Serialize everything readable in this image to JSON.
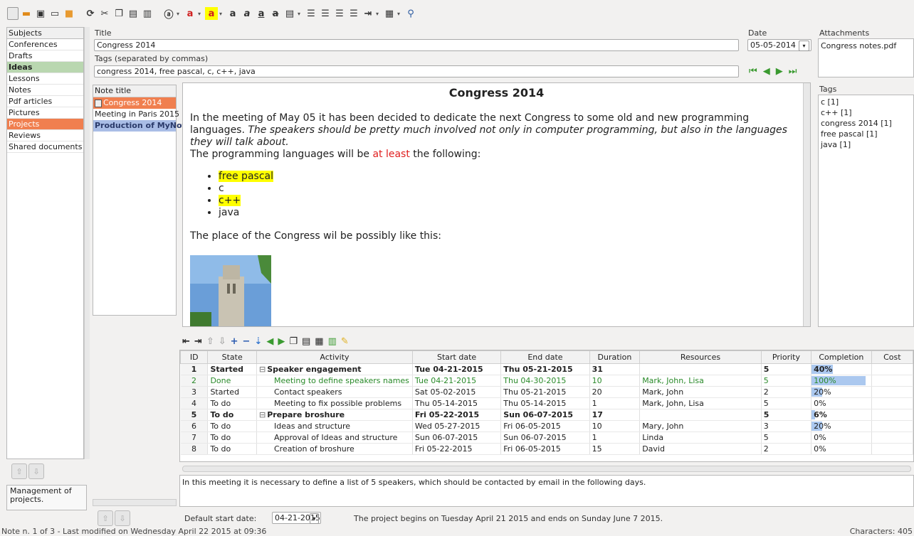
{
  "subjects": {
    "header": "Subjects",
    "items": [
      "Conferences",
      "Drafts",
      "Ideas",
      "Lessons",
      "Notes",
      "Pdf articles",
      "Pictures",
      "Projects",
      "Reviews",
      "Shared documents"
    ],
    "description": "Management of projects."
  },
  "fields": {
    "title_label": "Title",
    "title_value": "Congress 2014",
    "tags_label": "Tags (separated by commas)",
    "tags_value": "congress 2014, free pascal, c, c++, java",
    "date_label": "Date",
    "date_value": "05-05-2014",
    "attachments_label": "Attachments",
    "attachment_file": "Congress notes.pdf"
  },
  "notes": {
    "header": "Note title",
    "items": [
      "Congress 2014",
      "Meeting in Paris 2015",
      "Production of MyNotex"
    ]
  },
  "editor": {
    "heading": "Congress 2014",
    "p1_normal": "In the meeting of May 05 it has been decided to dedicate the next Congress to some old and new programming languages. ",
    "p1_italic": "The speakers should be pretty much involved not only in computer programming, but also in the languages they will talk about.",
    "p2_before": "The programming languages will be ",
    "p2_red": "at least",
    "p2_after": " the following:",
    "list": [
      "free pascal",
      "c",
      "c++",
      "java"
    ],
    "p3": "The place of the Congress wil be possibly like this:"
  },
  "tags_panel": {
    "header": "Tags",
    "items": [
      "c [1]",
      "c++ [1]",
      "congress 2014 [1]",
      "free pascal [1]",
      "java [1]"
    ]
  },
  "grid": {
    "columns": [
      "ID",
      "State",
      "Activity",
      "Start date",
      "End date",
      "Duration",
      "Resources",
      "Priority",
      "Completion",
      "Cost"
    ],
    "rows": [
      {
        "id": "1",
        "state": "Started",
        "activity": "Speaker engagement",
        "start": "Tue 04-21-2015",
        "end": "Thu 05-21-2015",
        "duration": "31",
        "resources": "",
        "priority": "5",
        "completion": "40%",
        "pct": 0.4,
        "group": true
      },
      {
        "id": "2",
        "state": "Done",
        "activity": "Meeting to define speakers names",
        "start": "Tue 04-21-2015",
        "end": "Thu 04-30-2015",
        "duration": "10",
        "resources": "Mark, John, Lisa",
        "priority": "5",
        "completion": "100%",
        "pct": 1.0,
        "done": true
      },
      {
        "id": "3",
        "state": "Started",
        "activity": "Contact speakers",
        "start": "Sat 05-02-2015",
        "end": "Thu 05-21-2015",
        "duration": "20",
        "resources": "Mark, John",
        "priority": "2",
        "completion": "20%",
        "pct": 0.2
      },
      {
        "id": "4",
        "state": "To do",
        "activity": "Meeting to fix possible problems",
        "start": "Thu 05-14-2015",
        "end": "Thu 05-14-2015",
        "duration": "1",
        "resources": "Mark, John, Lisa",
        "priority": "5",
        "completion": "0%",
        "pct": 0
      },
      {
        "id": "5",
        "state": "To do",
        "activity": "Prepare broshure",
        "start": "Fri 05-22-2015",
        "end": "Sun 06-07-2015",
        "duration": "17",
        "resources": "",
        "priority": "5",
        "completion": "6%",
        "pct": 0.06,
        "group": true
      },
      {
        "id": "6",
        "state": "To do",
        "activity": "Ideas and structure",
        "start": "Wed 05-27-2015",
        "end": "Fri 06-05-2015",
        "duration": "10",
        "resources": "Mary, John",
        "priority": "3",
        "completion": "20%",
        "pct": 0.2
      },
      {
        "id": "7",
        "state": "To do",
        "activity": "Approval of Ideas and structure",
        "start": "Sun 06-07-2015",
        "end": "Sun 06-07-2015",
        "duration": "1",
        "resources": "Linda",
        "priority": "5",
        "completion": "0%",
        "pct": 0
      },
      {
        "id": "8",
        "state": "To do",
        "activity": "Creation of broshure",
        "start": "Fri 05-22-2015",
        "end": "Fri 06-05-2015",
        "duration": "15",
        "resources": "David",
        "priority": "2",
        "completion": "0%",
        "pct": 0
      }
    ]
  },
  "activity_description": "In this meeting it is necessary to define a list of 5 speakers, which should be contacted by email in the following days.",
  "footer": {
    "default_start_label": "Default start date:",
    "default_start_value": "04-21-2015",
    "project_info": "The project begins on Tuesday April 21 2015 and ends on Sunday June 7 2015."
  },
  "status": {
    "left": "Note n. 1 of 3 - Last modified on Wednesday April 22 2015 at 09:36",
    "right": "Characters: 405"
  },
  "colors": {
    "accent_orange": "#f07f4f",
    "ideas_green": "#b9d7b0",
    "notes_blue": "#a9bde6",
    "done_green": "#2a8a2a",
    "highlight": "#ffff00"
  }
}
